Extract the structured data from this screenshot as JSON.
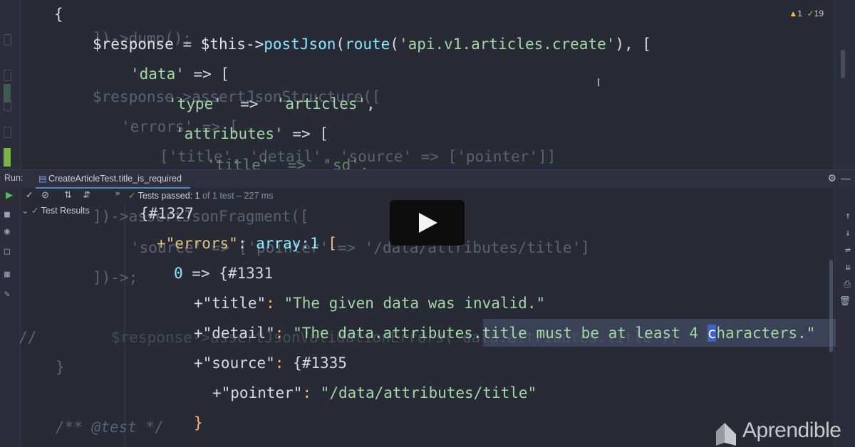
{
  "status": {
    "warnings": "1",
    "checks": "19"
  },
  "run": {
    "label": "Run:",
    "tab": "CreateArticleTest.title_is_required",
    "passed_label": "Tests passed:",
    "passed_count": "1",
    "passed_suffix": "of 1 test – 227 ms",
    "tree_root": "Test Results"
  },
  "code": {
    "brace_open": "{",
    "bg_dump": "])->dump();",
    "l_response": "$response",
    "l_eq": " = ",
    "l_this": "$this->",
    "l_post": "postJson",
    "l_paren": "(",
    "l_route": "route",
    "l_route_arg": "'api.v1.articles.create'",
    "l_close": "), [",
    "l_data": "'data'",
    "l_arrow": " => [",
    "bg_assert": "$response->assertJsonStructure([",
    "l_type": "'type'",
    "l_type_arrow": "  =>  ",
    "l_type_val": "'articles'",
    "l_comma": ",",
    "bg_errors": "'errors' => [",
    "l_attributes": "'attributes'",
    "l_attr_arrow": " => [",
    "bg_title_line": "['title', 'detail', 'source' => ['pointer']]",
    "l_title_frag": "'title'  =>  'sd',",
    "bg_fragment": "])->assertJsonFragment([",
    "bg_source_line": "'source' => ['pointer' => '/data/attributes/title']",
    "bg_close": "])->",
    "bg_close_semi": ";",
    "bg_comment": "//",
    "bg_validation": "$response->assertJsonValidationErrors('data.attributes.title');",
    "bg_brace": "}",
    "bg_doc": "/** @test */"
  },
  "dump": {
    "id1327": "{#1327",
    "errors_key": "+\"errors\"",
    "errors_colon": ": ",
    "errors_type": "array:1",
    "errors_bracket": " [",
    "idx": "0",
    "idx_arrow": " => ",
    "id1331": "{#1331",
    "title_key": "+\"title\"",
    "title_val": "\"The given data was invalid.\"",
    "detail_key": "+\"detail\"",
    "detail_val_a": "\"The data.attributes.title must be at least 4 ",
    "detail_val_c": "c",
    "detail_val_b": "haracters.\"",
    "source_key": "+\"source\"",
    "id1335": "{#1335",
    "pointer_key": "+\"pointer\"",
    "pointer_val": "\"/data/attributes/title\"",
    "brace_close": "}",
    "colon": ": "
  },
  "brand": {
    "name": "Aprendible"
  }
}
